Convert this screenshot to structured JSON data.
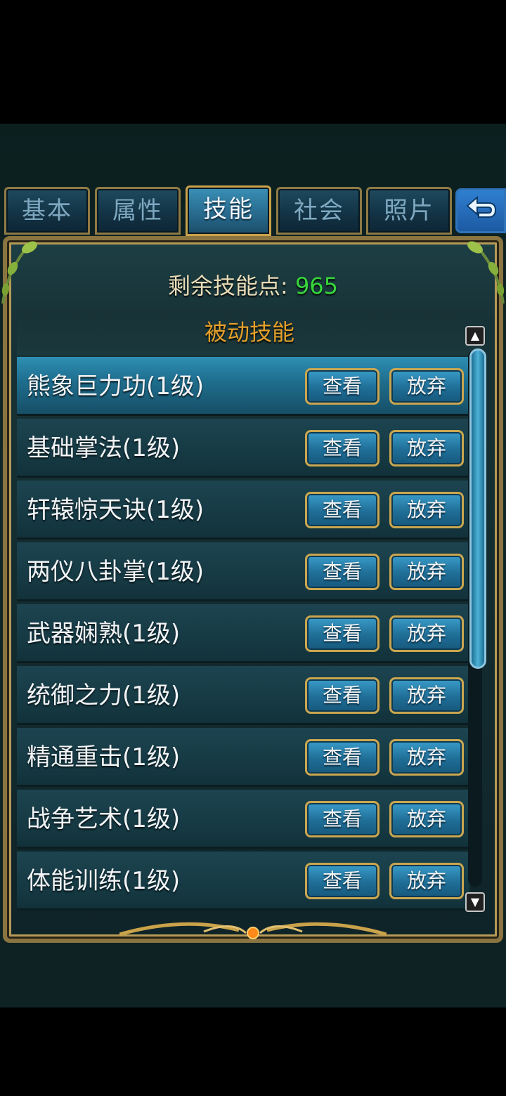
{
  "tabs": [
    {
      "label": "基本"
    },
    {
      "label": "属性"
    },
    {
      "label": "技能",
      "active": true
    },
    {
      "label": "社会"
    },
    {
      "label": "照片"
    }
  ],
  "back_icon": "back-arrow-icon",
  "skill_points": {
    "label": "剩余技能点:",
    "value": "965"
  },
  "section_title": "被动技能",
  "view_label": "查看",
  "drop_label": "放弃",
  "skills": [
    {
      "name": "熊象巨力功(1级)",
      "selected": true
    },
    {
      "name": "基础掌法(1级)"
    },
    {
      "name": "轩辕惊天诀(1级)"
    },
    {
      "name": "两仪八卦掌(1级)"
    },
    {
      "name": "武器娴熟(1级)"
    },
    {
      "name": "统御之力(1级)"
    },
    {
      "name": "精通重击(1级)"
    },
    {
      "name": "战争艺术(1级)"
    },
    {
      "name": "体能训练(1级)"
    }
  ],
  "colors": {
    "accent": "#36d63a",
    "gold": "#caa650",
    "section": "#e4a02a"
  }
}
